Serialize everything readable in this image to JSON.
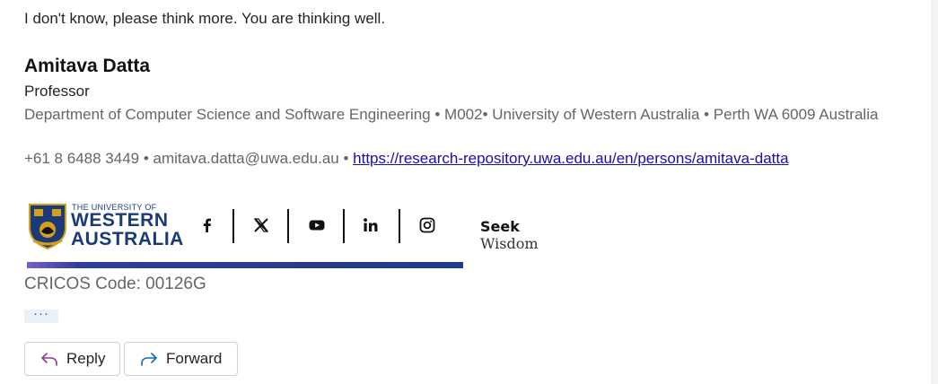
{
  "email": {
    "body_text": "I don't know, please think more. You are thinking well."
  },
  "signature": {
    "name": "Amitava Datta",
    "title": "Professor",
    "department_line": "Department of Computer Science and Software Engineering  • M002• University of Western Australia • Perth WA 6009 Australia",
    "phone": "+61 8 6488 3449",
    "email": "amitava.datta@uwa.edu.au",
    "separator": " • ",
    "url": "https://research-repository.uwa.edu.au/en/persons/amitava-datta"
  },
  "banner": {
    "uni_small": "THE UNIVERSITY OF",
    "uni_line1": "WESTERN",
    "uni_line2": "AUSTRALIA",
    "motto_line1": "Seek",
    "motto_line2": "Wisdom",
    "social_icons": [
      "facebook-icon",
      "x-icon",
      "youtube-icon",
      "linkedin-icon",
      "instagram-icon"
    ],
    "colors": {
      "brand_blue": "#1b3a7a",
      "gold": "#d4a017"
    }
  },
  "cricos": "CRICOS Code: 00126G",
  "ellipsis": "···",
  "actions": {
    "reply_label": "Reply",
    "forward_label": "Forward",
    "colors": {
      "reply_icon": "#8b3a8b",
      "forward_icon": "#0f6cbd"
    }
  }
}
